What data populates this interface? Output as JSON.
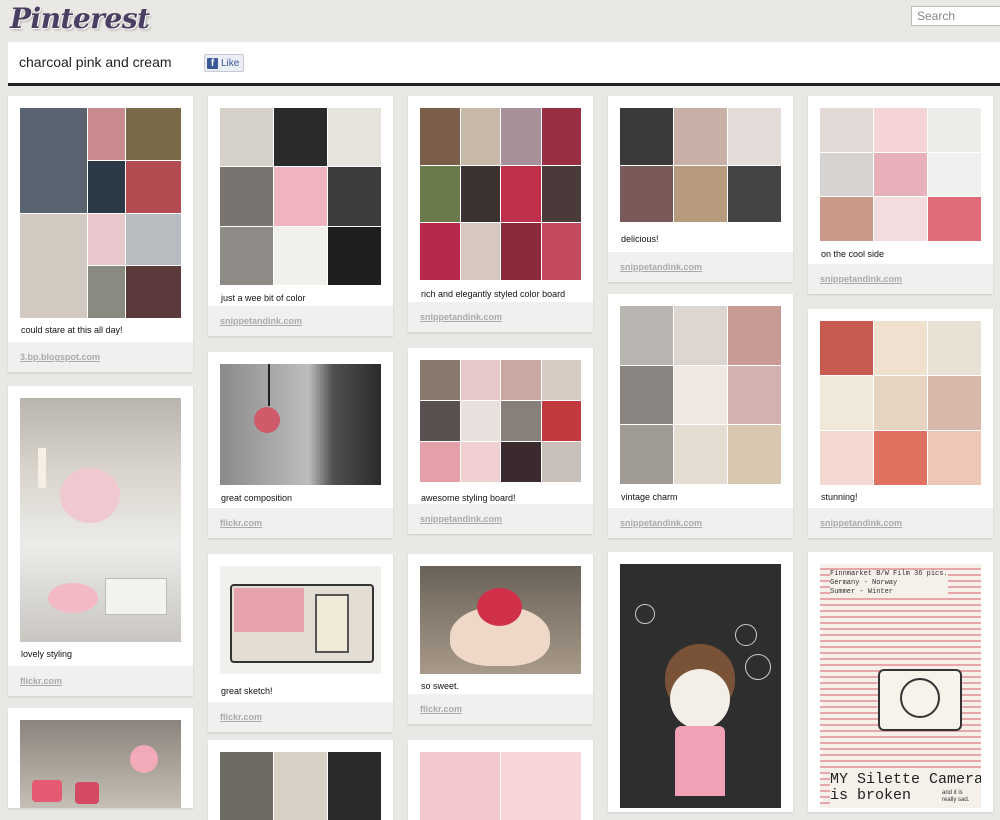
{
  "header": {
    "logo": "Pinterest",
    "search_placeholder": "Search"
  },
  "board": {
    "title": "charcoal pink and cream",
    "like_label": "Like"
  },
  "pins": [
    {
      "caption": "could stare at this all day!",
      "source": "3.bp.blogspot.com"
    },
    {
      "caption": "lovely styling",
      "source": "flickr.com"
    },
    {
      "caption": "",
      "source": ""
    },
    {
      "caption": "just a wee bit of color",
      "source": "snippetandink.com"
    },
    {
      "caption": "great composition",
      "source": "flickr.com"
    },
    {
      "caption": "great sketch!",
      "source": "flickr.com"
    },
    {
      "caption": "",
      "source": ""
    },
    {
      "caption": "rich and elegantly styled color board",
      "source": "snippetandink.com"
    },
    {
      "caption": "awesome styling board!",
      "source": "snippetandink.com"
    },
    {
      "caption": "so sweet.",
      "source": "flickr.com"
    },
    {
      "caption": "",
      "source": ""
    },
    {
      "caption": "delicious!",
      "source": "snippetandink.com"
    },
    {
      "caption": "vintage charm",
      "source": "snippetandink.com"
    },
    {
      "caption": "",
      "source": ""
    },
    {
      "caption": "on the cool side",
      "source": "snippetandink.com"
    },
    {
      "caption": "stunning!",
      "source": "snippetandink.com"
    },
    {
      "caption": "",
      "source": ""
    }
  ],
  "sketch_text": {
    "line1": "Finnmarket  B/W Film  36 pics.",
    "line2": "Germany - Norway",
    "line3": "Summer - Winter",
    "big1": "MY Silette Camera",
    "big2": "is broken",
    "small": "and it is really sad."
  },
  "colors": {
    "logo": "#4a3e62",
    "page_bg": "#e9e8e4",
    "facebook": "#3b5998",
    "pink": "#d4707e",
    "charcoal": "#3a3a3a",
    "cream": "#efe9df"
  }
}
